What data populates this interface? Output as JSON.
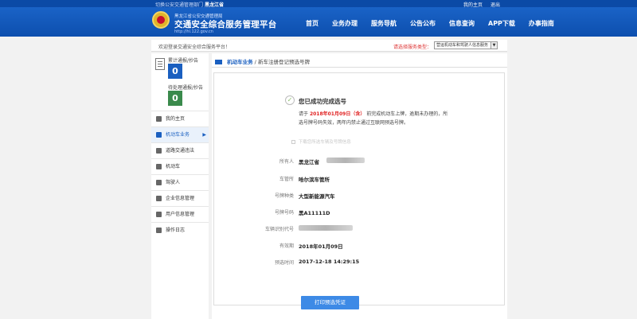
{
  "topbar": {
    "city_prefix": "切换公安交通管理部门",
    "city": "黑龙江省",
    "links": [
      "我的主页",
      "退出"
    ]
  },
  "header": {
    "subtitle": "黑龙江省公安交通管理局",
    "title": "交通安全综合服务管理平台",
    "url": "http://hl.122.gov.cn",
    "nav": [
      "首页",
      "业务办理",
      "服务导航",
      "公告公布",
      "信息查询",
      "APP下载",
      "办事指南"
    ]
  },
  "welcome": {
    "text": "欢迎登录交通安全综合服务平台！",
    "service_label": "请选择服务类型：",
    "service_value": "营运机动车和驾驶人信息服务"
  },
  "sidebar": {
    "stats": [
      {
        "label": "累计通报/抄告",
        "value": "0",
        "color": "#1a5fc0"
      },
      {
        "label": "待处理通报/抄告",
        "value": "0",
        "color": "#3a8a4c"
      }
    ],
    "items": [
      {
        "label": "我的主页",
        "icon": "home-icon"
      },
      {
        "label": "机动车业务",
        "icon": "truck-icon",
        "active": true
      },
      {
        "label": "道路交通违法",
        "icon": "warning-icon"
      },
      {
        "label": "机动车",
        "icon": "car-icon"
      },
      {
        "label": "驾驶人",
        "icon": "user-icon"
      },
      {
        "label": "企业信息管理",
        "icon": "people-icon"
      },
      {
        "label": "用户信息管理",
        "icon": "id-card-icon"
      },
      {
        "label": "操作日志",
        "icon": "log-icon"
      }
    ]
  },
  "breadcrumb": {
    "section": "机动车业务",
    "separator": "/",
    "page": "新车注册登记预选号牌"
  },
  "result": {
    "title": "您已成功完成选号",
    "msg_before": "请于",
    "deadline": "2018年01月09日（含）",
    "msg_after": "前完成机动车上牌，逾期未办理的，所选号牌号码失效，两年内禁止通过互联网预选号牌。",
    "faint_option": "下载您所选车辆及号牌信息"
  },
  "details": [
    {
      "key": "所有人",
      "value": "黑龙江省"
    },
    {
      "key": "车管所",
      "value": "哈尔滨车管所"
    },
    {
      "key": "号牌种类",
      "value": "大型新能源汽车"
    },
    {
      "key": "号牌号码",
      "value": "黑A11111D"
    },
    {
      "key": "车辆识别代号",
      "value": ""
    },
    {
      "key": "有效期",
      "value": "2018年01月09日"
    },
    {
      "key": "预选时间",
      "value": "2017-12-18 14:29:15"
    }
  ],
  "actions": {
    "print_label": "打印预选凭证"
  }
}
